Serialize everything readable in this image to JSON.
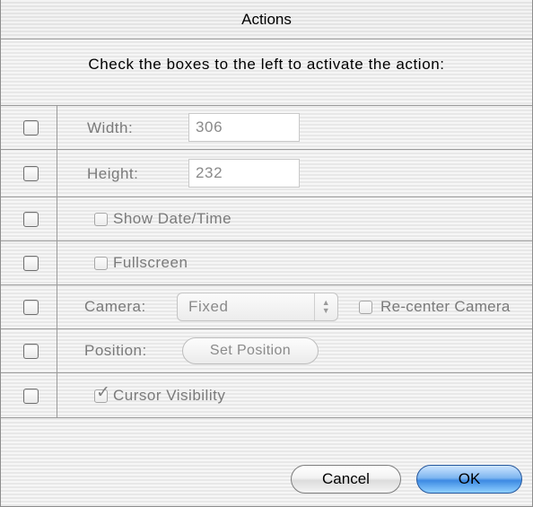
{
  "window": {
    "title": "Actions"
  },
  "instructions": "Check the boxes to the left to activate the action:",
  "rows": {
    "width": {
      "label": "Width:",
      "value": "306"
    },
    "height": {
      "label": "Height:",
      "value": "232"
    },
    "show_date_time": {
      "label": "Show Date/Time",
      "checked": false
    },
    "fullscreen": {
      "label": "Fullscreen",
      "checked": false
    },
    "camera": {
      "label": "Camera:",
      "selected": "Fixed",
      "recenter_label": "Re-center Camera",
      "recenter_checked": false
    },
    "position": {
      "label": "Position:",
      "button_label": "Set Position"
    },
    "cursor_visibility": {
      "label": "Cursor Visibility",
      "checked": true
    }
  },
  "buttons": {
    "cancel": "Cancel",
    "ok": "OK"
  },
  "colors": {
    "accent": "#3d8ae3",
    "disabled_text": "#7a7a7a"
  },
  "icons": {
    "popup_arrows": "up-down-arrows-icon",
    "check": "checkmark-icon"
  }
}
